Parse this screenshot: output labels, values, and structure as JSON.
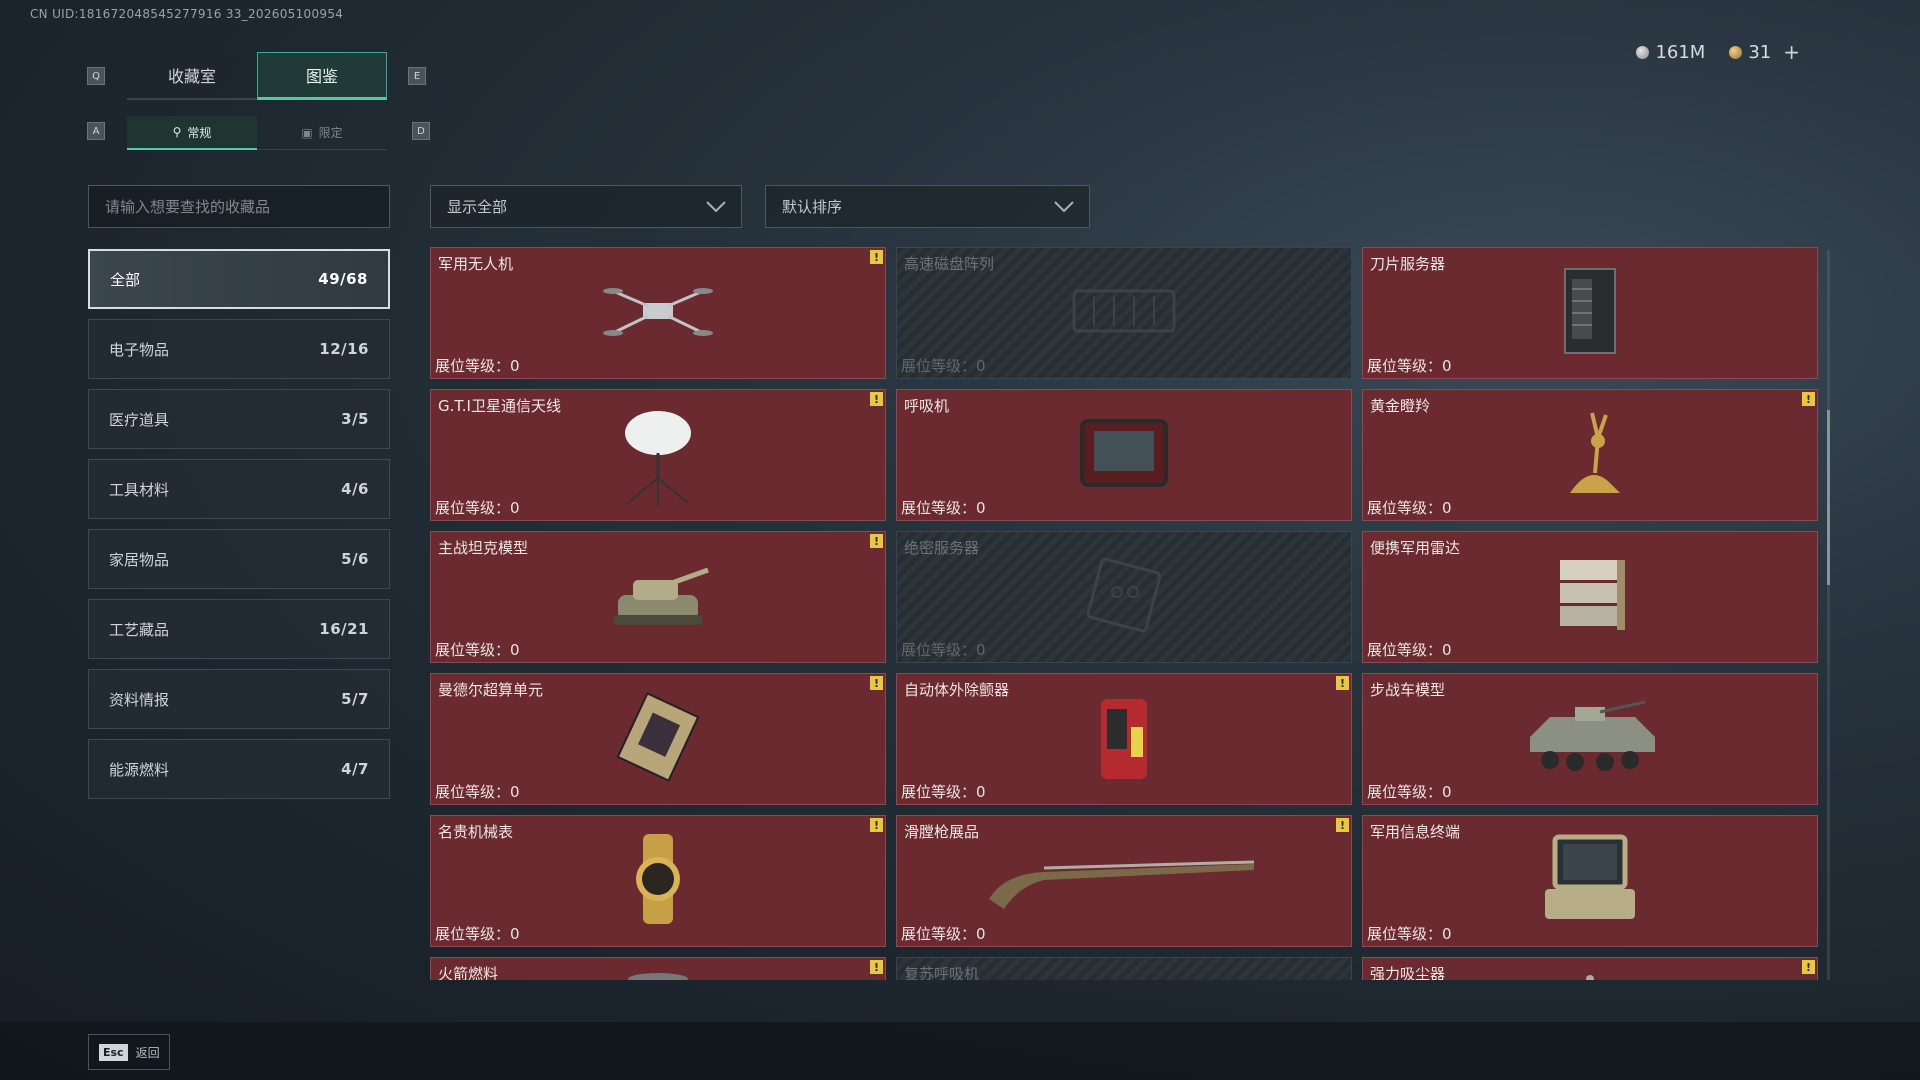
{
  "uid": "CN UID:181672048545277916 33_202605100954",
  "currency": {
    "silver": "161M",
    "gold": "31",
    "plus": "+"
  },
  "keys": {
    "q": "Q",
    "e": "E",
    "a": "A",
    "d": "D"
  },
  "tabs": [
    {
      "label": "收藏室",
      "active": false
    },
    {
      "label": "图鉴",
      "active": true
    }
  ],
  "subtabs": [
    {
      "label": "常规",
      "active": true
    },
    {
      "label": "限定",
      "active": false
    }
  ],
  "search": {
    "placeholder": "请输入想要查找的收藏品"
  },
  "categories": [
    {
      "label": "全部",
      "count": "49/68",
      "active": true
    },
    {
      "label": "电子物品",
      "count": "12/16"
    },
    {
      "label": "医疗道具",
      "count": "3/5"
    },
    {
      "label": "工具材料",
      "count": "4/6"
    },
    {
      "label": "家居物品",
      "count": "5/6"
    },
    {
      "label": "工艺藏品",
      "count": "16/21"
    },
    {
      "label": "资料情报",
      "count": "5/7"
    },
    {
      "label": "能源燃料",
      "count": "4/7"
    }
  ],
  "filter": {
    "label": "显示全部"
  },
  "sort": {
    "label": "默认排序"
  },
  "level_label": "展位等级：0",
  "items": [
    {
      "name": "军用无人机",
      "locked": false,
      "badge": true,
      "icon": "drone-icon"
    },
    {
      "name": "高速磁盘阵列",
      "locked": true,
      "badge": false,
      "icon": "disk-array-icon"
    },
    {
      "name": "刀片服务器",
      "locked": false,
      "badge": false,
      "icon": "blade-server-icon"
    },
    {
      "name": "G.T.I卫星通信天线",
      "locked": false,
      "badge": true,
      "icon": "satellite-dish-icon"
    },
    {
      "name": "呼吸机",
      "locked": false,
      "badge": false,
      "icon": "ventilator-icon"
    },
    {
      "name": "黄金瞪羚",
      "locked": false,
      "badge": true,
      "icon": "golden-gazelle-icon"
    },
    {
      "name": "主战坦克模型",
      "locked": false,
      "badge": true,
      "icon": "tank-model-icon"
    },
    {
      "name": "绝密服务器",
      "locked": true,
      "badge": false,
      "icon": "secret-server-icon"
    },
    {
      "name": "便携军用雷达",
      "locked": false,
      "badge": false,
      "icon": "radar-icon"
    },
    {
      "name": "曼德尔超算单元",
      "locked": false,
      "badge": true,
      "icon": "supercomputer-unit-icon"
    },
    {
      "name": "自动体外除颤器",
      "locked": false,
      "badge": true,
      "icon": "defibrillator-icon"
    },
    {
      "name": "步战车模型",
      "locked": false,
      "badge": false,
      "icon": "ifv-model-icon"
    },
    {
      "name": "名贵机械表",
      "locked": false,
      "badge": true,
      "icon": "watch-icon"
    },
    {
      "name": "滑膛枪展品",
      "locked": false,
      "badge": true,
      "icon": "musket-icon"
    },
    {
      "name": "军用信息终端",
      "locked": false,
      "badge": false,
      "icon": "military-terminal-icon"
    },
    {
      "name": "火箭燃料",
      "locked": false,
      "badge": true,
      "icon": "rocket-fuel-icon"
    },
    {
      "name": "复苏呼吸机",
      "locked": true,
      "badge": false,
      "icon": "resuscitator-icon"
    },
    {
      "name": "强力吸尘器",
      "locked": false,
      "badge": true,
      "icon": "vacuum-icon"
    }
  ],
  "badge_symbol": "!",
  "footer": {
    "esc_key": "Esc",
    "back_label": "返回"
  }
}
